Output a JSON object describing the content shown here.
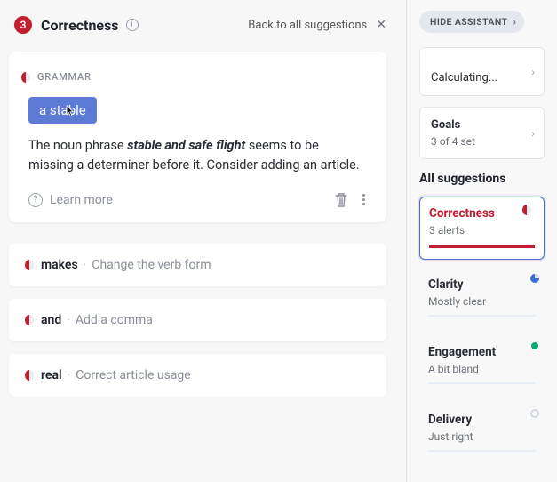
{
  "header": {
    "count": "3",
    "title": "Correctness",
    "back_label": "Back to all suggestions"
  },
  "card": {
    "category": "GRAMMAR",
    "chip": "a stable",
    "desc_prefix": "The noun phrase ",
    "desc_bold": "stable and safe flight",
    "desc_suffix": " seems to be missing a determiner before it. Consider adding an article.",
    "learn_more": "Learn more"
  },
  "suggestions": [
    {
      "word": "makes",
      "hint": "Change the verb form"
    },
    {
      "word": "and",
      "hint": "Add a comma"
    },
    {
      "word": "real",
      "hint": "Correct article usage"
    }
  ],
  "sidebar": {
    "hide_label": "HIDE ASSISTANT",
    "calculating": "Calculating...",
    "goals_title": "Goals",
    "goals_sub": "3 of 4 set",
    "all_title": "All suggestions",
    "cats": [
      {
        "title": "Correctness",
        "sub": "3 alerts"
      },
      {
        "title": "Clarity",
        "sub": "Mostly clear"
      },
      {
        "title": "Engagement",
        "sub": "A bit bland"
      },
      {
        "title": "Delivery",
        "sub": "Just right"
      }
    ]
  }
}
